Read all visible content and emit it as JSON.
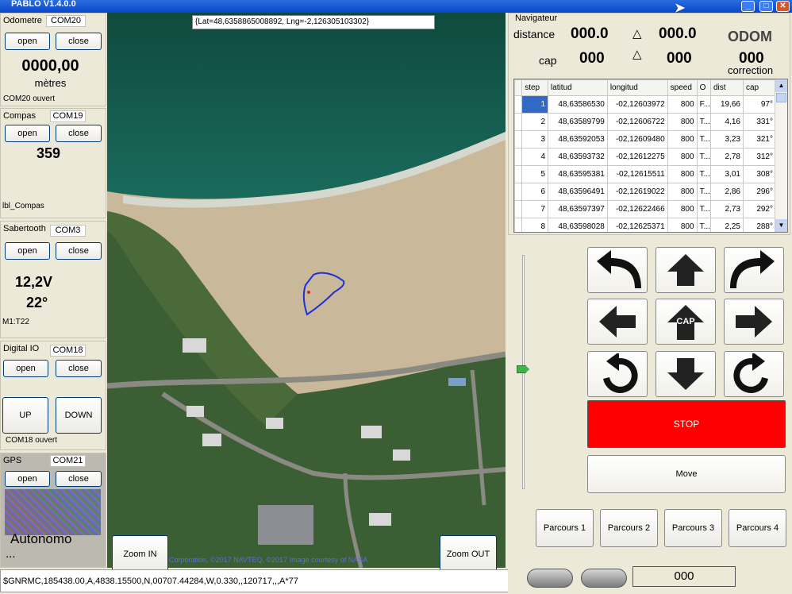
{
  "window": {
    "title": "PABLO V1.4.0.0",
    "controls": [
      "minimize-icon",
      "maximize-icon",
      "close-icon"
    ]
  },
  "map": {
    "coordinates": "{Lat=48,6358865008892, Lng=-2,126305103302}",
    "copyright": "Corporation, ©2017 NAVTEQ, ©2017 Image courtesy of NASA",
    "zoom_in_label": "Zoom IN",
    "zoom_out_label": "Zoom OUT"
  },
  "odometre": {
    "label": "Odometre",
    "port": "COM20",
    "open_label": "open",
    "close_label": "close",
    "value": "0000,00",
    "unit": "mètres",
    "status": "COM20 ouvert"
  },
  "compas": {
    "label": "Compas",
    "port": "COM19",
    "open_label": "open",
    "close_label": "close",
    "value": "359",
    "status": "lbl_Compas"
  },
  "sabertooth": {
    "label": "Sabertooth",
    "port": "COM3",
    "open_label": "open",
    "close_label": "close",
    "voltage": "12,2V",
    "temperature": "22°",
    "status": "M1:T22"
  },
  "digital_io": {
    "label": "Digital IO",
    "port": "COM18",
    "open_label": "open",
    "close_label": "close",
    "up_label": "UP",
    "down_label": "DOWN",
    "status": "COM18 ouvert"
  },
  "gps": {
    "label": "GPS",
    "port": "COM21",
    "open_label": "open",
    "close_label": "close",
    "mode": "Autonomo",
    "mode_suffix": "..."
  },
  "status_bar": {
    "nmea": "$GNRMC,185438.00,A,4838.15500,N,00707.44284,W,0.330,,120717,,,A*77"
  },
  "navigateur": {
    "title": "Navigateur",
    "distance_label": "distance",
    "distance_value": "000.0",
    "distance_delta": "000.0",
    "cap_label": "cap",
    "cap_value": "000",
    "cap_delta": "000",
    "delta_symbol": "△",
    "odom_label": "ODOM",
    "correction_value": "000",
    "correction_label": "correction"
  },
  "waypoints": {
    "columns": [
      "step",
      "latitud",
      "longitud",
      "speed",
      "O",
      "dist",
      "cap"
    ],
    "rows": [
      {
        "step": "1",
        "lat": "48,63586530",
        "lng": "-02,12603972",
        "speed": "800",
        "o": "F...",
        "dist": "19,66",
        "cap": "97°"
      },
      {
        "step": "2",
        "lat": "48,63589799",
        "lng": "-02,12606722",
        "speed": "800",
        "o": "T...",
        "dist": "4,16",
        "cap": "331°"
      },
      {
        "step": "3",
        "lat": "48,63592053",
        "lng": "-02,12609480",
        "speed": "800",
        "o": "T...",
        "dist": "3,23",
        "cap": "321°"
      },
      {
        "step": "4",
        "lat": "48,63593732",
        "lng": "-02,12612275",
        "speed": "800",
        "o": "T...",
        "dist": "2,78",
        "cap": "312°"
      },
      {
        "step": "5",
        "lat": "48,63595381",
        "lng": "-02,12615511",
        "speed": "800",
        "o": "T...",
        "dist": "3,01",
        "cap": "308°"
      },
      {
        "step": "6",
        "lat": "48,63596491",
        "lng": "-02,12619022",
        "speed": "800",
        "o": "T...",
        "dist": "2,86",
        "cap": "296°"
      },
      {
        "step": "7",
        "lat": "48,63597397",
        "lng": "-02,12622466",
        "speed": "800",
        "o": "T...",
        "dist": "2,73",
        "cap": "292°"
      },
      {
        "step": "8",
        "lat": "48,63598028",
        "lng": "-02,12625371",
        "speed": "800",
        "o": "T...",
        "dist": "2,25",
        "cap": "288°"
      }
    ]
  },
  "controls": {
    "cap_label": "CAP",
    "stop_label": "STOP",
    "move_label": "Move",
    "parcours": [
      "Parcours 1",
      "Parcours 2",
      "Parcours 3",
      "Parcours 4"
    ],
    "bottom_value": "000",
    "stop_color": "#ff0000"
  }
}
